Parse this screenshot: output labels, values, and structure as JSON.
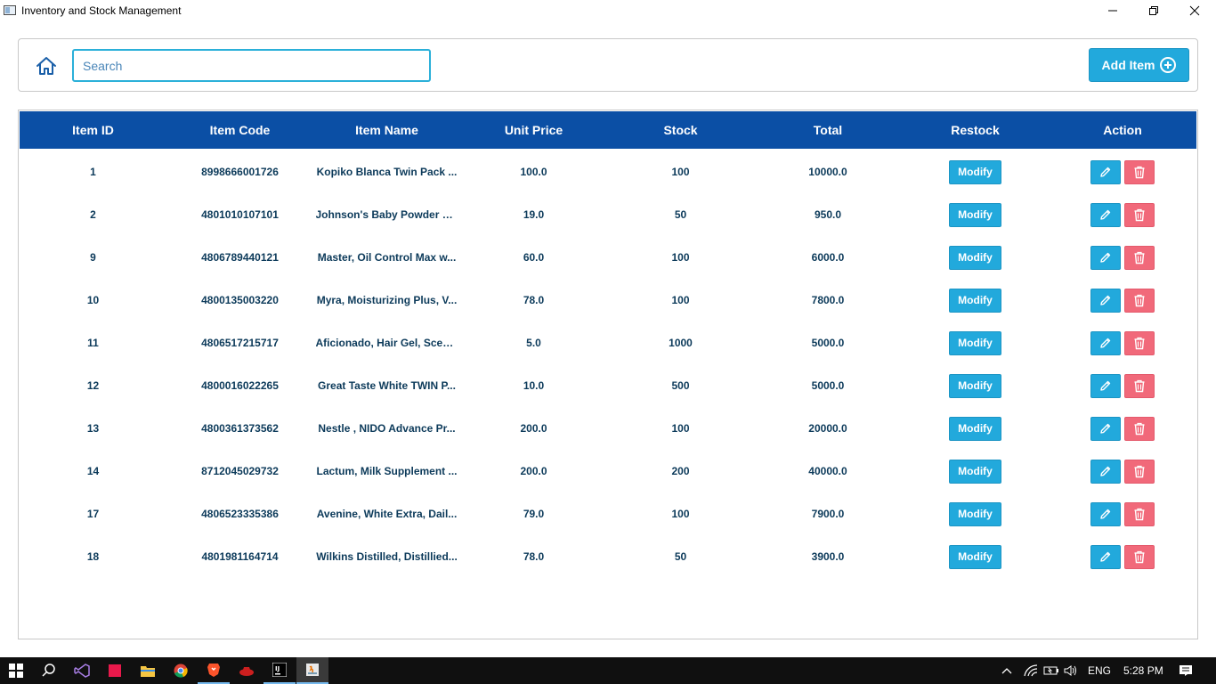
{
  "window": {
    "title": "Inventory and Stock Management"
  },
  "header": {
    "search": {
      "placeholder": "Search",
      "value": ""
    },
    "add_button_label": "Add Item"
  },
  "table": {
    "columns": [
      "Item ID",
      "Item Code",
      "Item Name",
      "Unit Price",
      "Stock",
      "Total",
      "Restock",
      "Action"
    ],
    "modify_label": "Modify",
    "rows": [
      {
        "id": "1",
        "code": "8998666001726",
        "name": "Kopiko Blanca Twin Pack ...",
        "price": "100.0",
        "stock": "100",
        "total": "10000.0"
      },
      {
        "id": "2",
        "code": "4801010107101",
        "name": "Johnson's Baby Powder C...",
        "price": "19.0",
        "stock": "50",
        "total": "950.0"
      },
      {
        "id": "9",
        "code": "4806789440121",
        "name": "Master, Oil Control Max w...",
        "price": "60.0",
        "stock": "100",
        "total": "6000.0"
      },
      {
        "id": "10",
        "code": "4800135003220",
        "name": "Myra, Moisturizing Plus, V...",
        "price": "78.0",
        "stock": "100",
        "total": "7800.0"
      },
      {
        "id": "11",
        "code": "4806517215717",
        "name": "Aficionado, Hair Gel, Scen...",
        "price": "5.0",
        "stock": "1000",
        "total": "5000.0"
      },
      {
        "id": "12",
        "code": "4800016022265",
        "name": "Great Taste White TWIN P...",
        "price": "10.0",
        "stock": "500",
        "total": "5000.0"
      },
      {
        "id": "13",
        "code": "4800361373562",
        "name": "Nestle , NIDO Advance Pr...",
        "price": "200.0",
        "stock": "100",
        "total": "20000.0"
      },
      {
        "id": "14",
        "code": "8712045029732",
        "name": "Lactum, Milk Supplement ...",
        "price": "200.0",
        "stock": "200",
        "total": "40000.0"
      },
      {
        "id": "17",
        "code": "4806523335386",
        "name": "Avenine, White Extra, Dail...",
        "price": "79.0",
        "stock": "100",
        "total": "7900.0"
      },
      {
        "id": "18",
        "code": "4801981164714",
        "name": "Wilkins Distilled, Distillied...",
        "price": "78.0",
        "stock": "50",
        "total": "3900.0"
      }
    ]
  },
  "taskbar": {
    "language": "ENG",
    "time": "5:28 PM"
  },
  "colors": {
    "header_blue": "#0b4fa5",
    "accent_blue": "#22a9dc",
    "delete_red": "#f1697a",
    "text_dark": "#0c3a5a"
  }
}
